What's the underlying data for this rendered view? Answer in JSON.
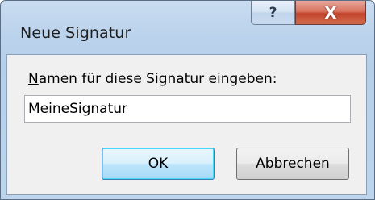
{
  "dialog": {
    "title": "Neue Signatur",
    "help_glyph": "?",
    "close_glyph": "X",
    "prompt_label_underlined": "N",
    "prompt_label_rest": "amen für diese Signatur eingeben:",
    "signature_name_value": "MeineSignatur",
    "ok_label": "OK",
    "cancel_label": "Abbrechen"
  },
  "colors": {
    "title_bar": "#bcd3ec",
    "close_button": "#c2452b",
    "client_bg": "#f0f0f0",
    "default_button_border": "#3c7fb1"
  },
  "icons": {
    "help": "help-icon",
    "close": "close-icon"
  }
}
